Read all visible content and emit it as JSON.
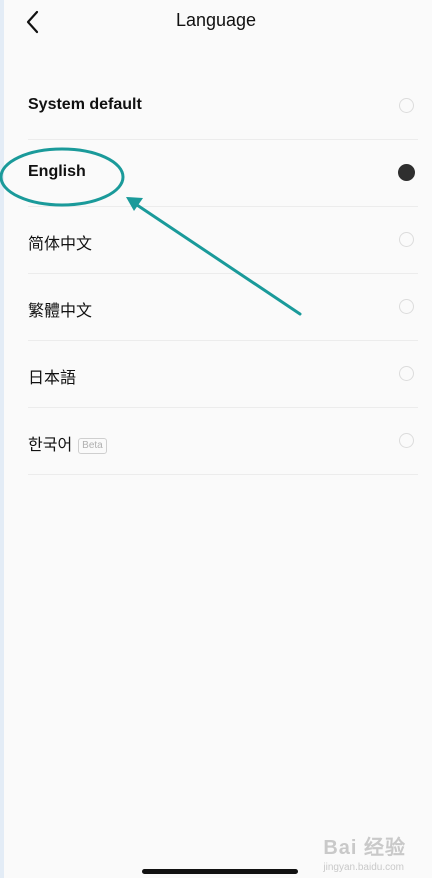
{
  "header": {
    "title": "Language",
    "back_icon": "chevron-left-icon"
  },
  "languages": [
    {
      "label": "System default",
      "selected": false
    },
    {
      "label": "English",
      "selected": true
    },
    {
      "label": "简体中文",
      "selected": false
    },
    {
      "label": "繁體中文",
      "selected": false
    },
    {
      "label": "日本語",
      "selected": false
    },
    {
      "label": "한국어",
      "badge": "Beta",
      "selected": false
    }
  ],
  "watermark": {
    "main": "Bai 经验",
    "sub": "jingyan.baidu.com"
  },
  "colors": {
    "annotation": "#1a9a9a",
    "radio_selected": "#2f2f2f",
    "radio_border": "#dcdcdc",
    "divider": "#ececec"
  }
}
